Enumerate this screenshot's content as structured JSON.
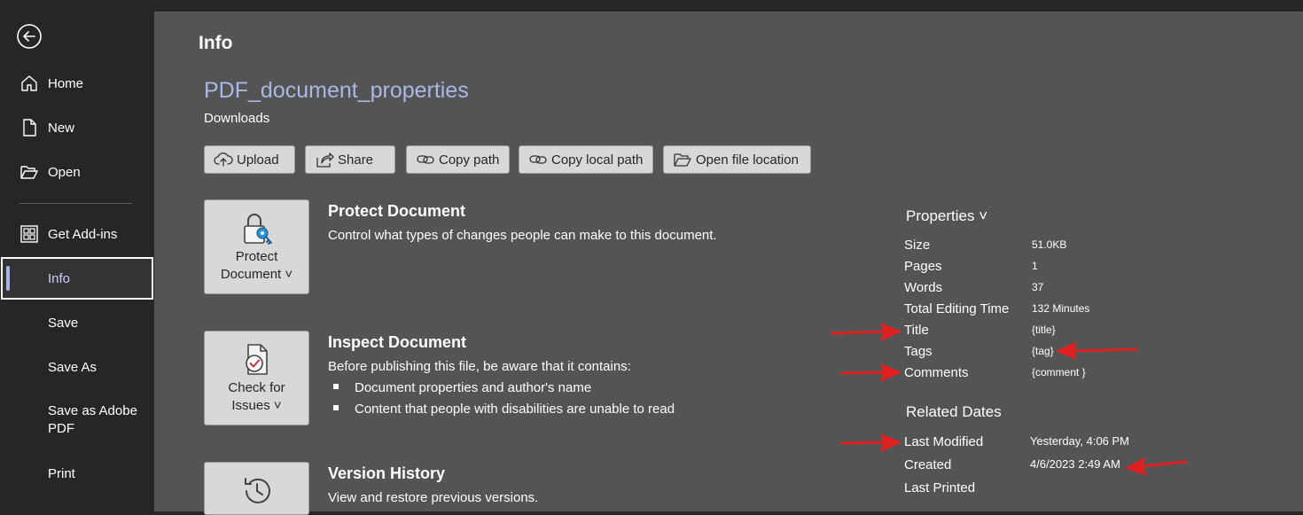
{
  "sidebar": {
    "back_icon": "back-arrow-icon",
    "items": [
      {
        "label": "Home",
        "icon": "home-icon"
      },
      {
        "label": "New",
        "icon": "new-document-icon"
      },
      {
        "label": "Open",
        "icon": "folder-open-icon"
      },
      {
        "label": "Get Add-ins",
        "icon": "grid-icon"
      },
      {
        "label": "Info"
      },
      {
        "label": "Save"
      },
      {
        "label": "Save As"
      },
      {
        "label": "Save as Adobe PDF"
      },
      {
        "label": "Print"
      }
    ],
    "active_item": "Info"
  },
  "main": {
    "title": "Info",
    "doc_name": "PDF_document_properties",
    "doc_location": "Downloads",
    "toolbar": [
      {
        "label": "Upload",
        "icon": "upload-cloud-icon"
      },
      {
        "label": "Share",
        "icon": "share-icon"
      },
      {
        "label": "Copy path",
        "icon": "link-icon"
      },
      {
        "label": "Copy local path",
        "icon": "link-icon"
      },
      {
        "label": "Open file location",
        "icon": "folder-open-icon"
      }
    ],
    "sections": {
      "protect": {
        "button_label_1": "Protect",
        "button_label_2": "Document ˅",
        "title": "Protect Document",
        "description": "Control what types of changes people can make to this document."
      },
      "inspect": {
        "button_label_1": "Check for",
        "button_label_2": "Issues ˅",
        "title": "Inspect Document",
        "description": "Before publishing this file, be aware that it contains:",
        "bullets": [
          "Document properties and author's name",
          "Content that people with disabilities are unable to read"
        ]
      },
      "version": {
        "title": "Version History",
        "description": "View and restore previous versions."
      }
    }
  },
  "properties": {
    "header": "Properties ˅",
    "rows": [
      {
        "label": "Size",
        "value": "51.0KB"
      },
      {
        "label": "Pages",
        "value": "1"
      },
      {
        "label": "Words",
        "value": "37"
      },
      {
        "label": "Total Editing Time",
        "value": "132 Minutes"
      },
      {
        "label": "Title",
        "value": "{title}"
      },
      {
        "label": "Tags",
        "value": "{tag}"
      },
      {
        "label": "Comments",
        "value": "{comment }"
      }
    ]
  },
  "related_dates": {
    "header": "Related Dates",
    "rows": [
      {
        "label": "Last Modified",
        "value": "Yesterday, 4:06 PM"
      },
      {
        "label": "Created",
        "value": "4/6/2023 2:49 AM"
      },
      {
        "label": "Last Printed",
        "value": ""
      }
    ]
  },
  "colors": {
    "sidebar_bg": "#262626",
    "main_bg": "#545454",
    "accent_link": "#a9b8e4",
    "annotation_arrow": "#e02020"
  }
}
